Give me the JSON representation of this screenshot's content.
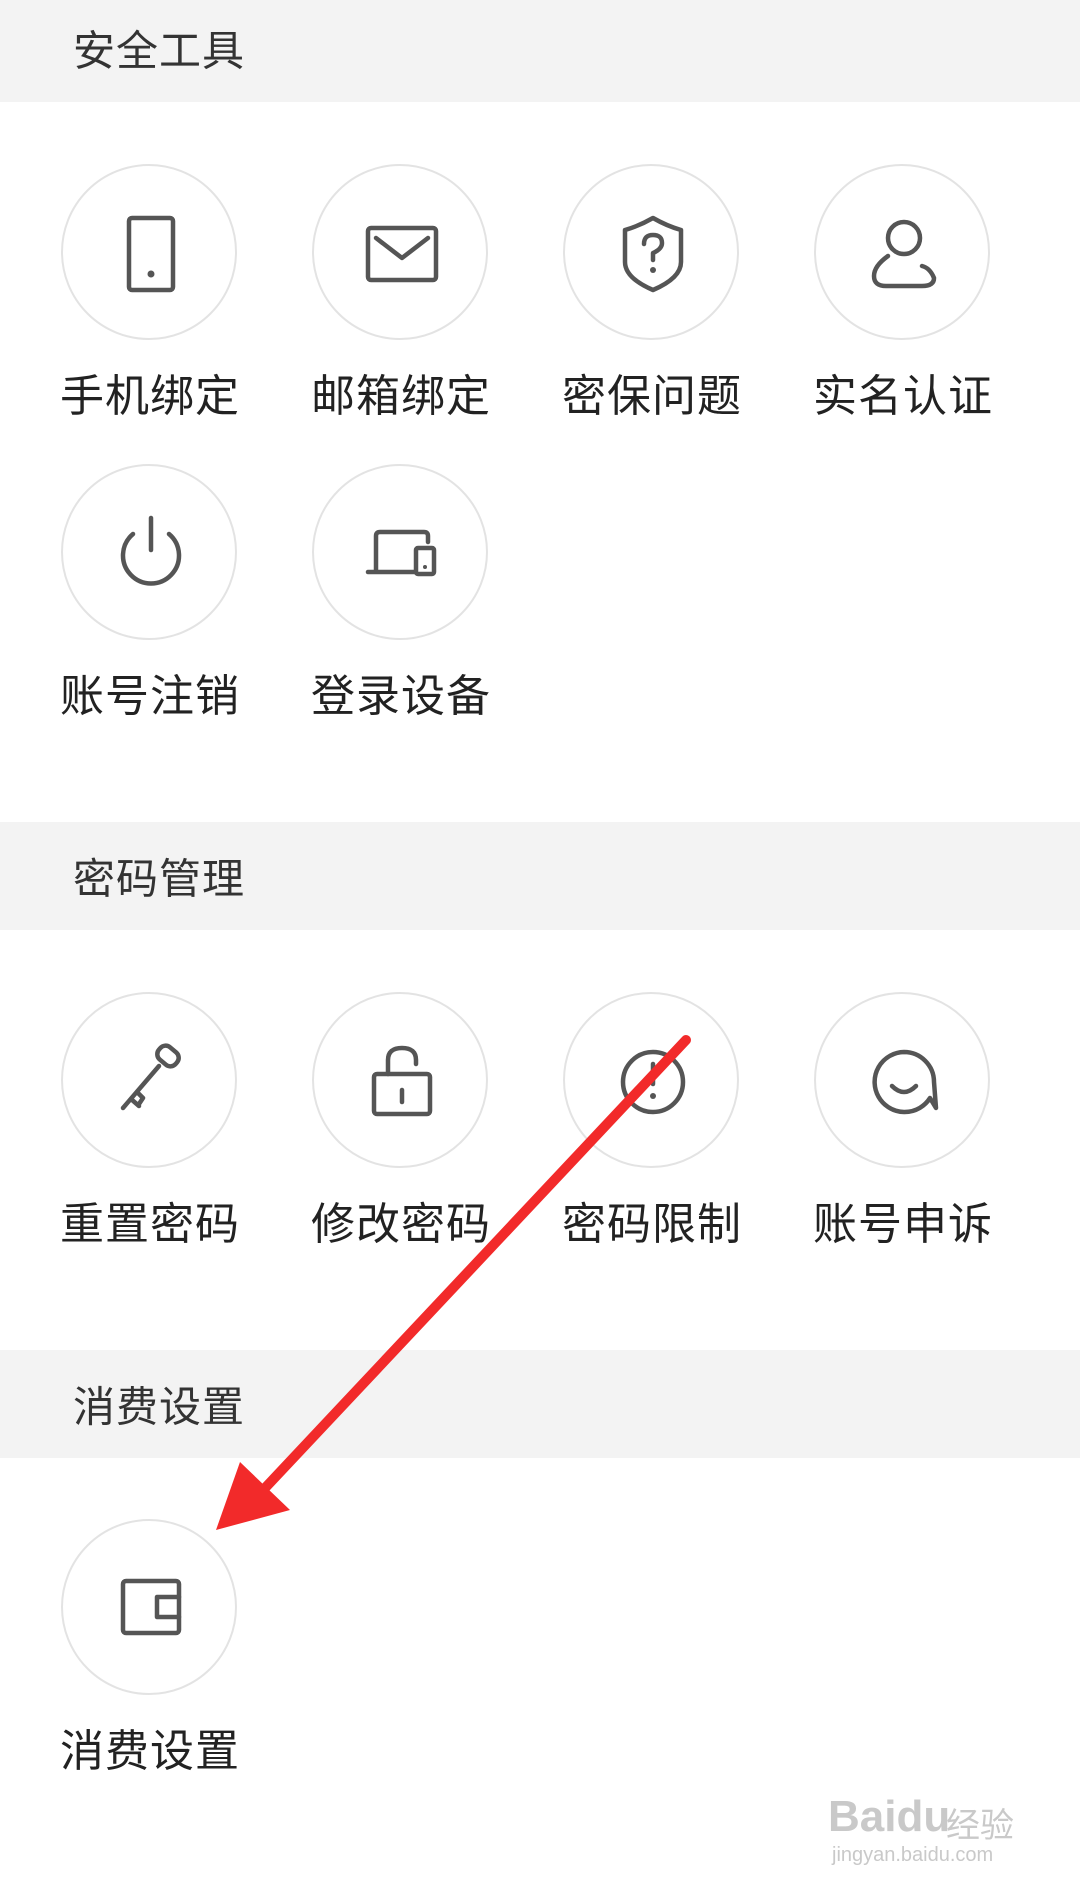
{
  "sections": [
    {
      "title": "安全工具",
      "items": [
        {
          "label": "手机绑定",
          "icon": "phone-icon"
        },
        {
          "label": "邮箱绑定",
          "icon": "mail-icon"
        },
        {
          "label": "密保问题",
          "icon": "shield-question-icon"
        },
        {
          "label": "实名认证",
          "icon": "user-icon"
        },
        {
          "label": "账号注销",
          "icon": "power-icon"
        },
        {
          "label": "登录设备",
          "icon": "devices-icon"
        }
      ]
    },
    {
      "title": "密码管理",
      "items": [
        {
          "label": "重置密码",
          "icon": "key-icon"
        },
        {
          "label": "修改密码",
          "icon": "unlock-icon"
        },
        {
          "label": "密码限制",
          "icon": "alert-circle-icon"
        },
        {
          "label": "账号申诉",
          "icon": "chat-smile-icon"
        }
      ]
    },
    {
      "title": "消费设置",
      "items": [
        {
          "label": "消费设置",
          "icon": "wallet-icon"
        }
      ]
    }
  ],
  "annotation": {
    "color": "#f22a2a"
  },
  "watermark": {
    "logo": "Baidu",
    "brand": "经验",
    "site": "jingyan.baidu.com"
  }
}
